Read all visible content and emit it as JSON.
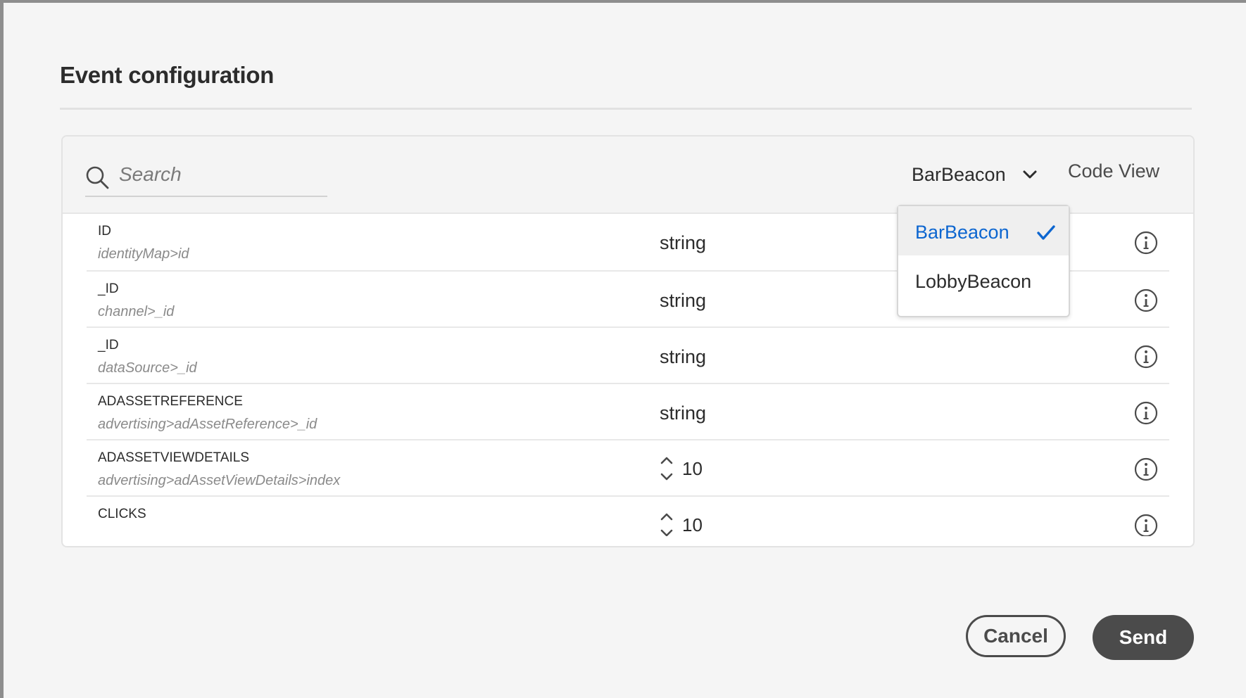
{
  "dialog": {
    "title": "Event configuration"
  },
  "search": {
    "placeholder": "Search"
  },
  "toolbar": {
    "selected_event": "BarBeacon",
    "code_view_label": "Code View"
  },
  "dropdown": {
    "options": [
      {
        "label": "BarBeacon",
        "selected": true
      },
      {
        "label": "LobbyBeacon",
        "selected": false
      }
    ]
  },
  "rows": [
    {
      "name": "ID",
      "path": "identityMap>id",
      "type": "string"
    },
    {
      "name": "_ID",
      "path": "channel>_id",
      "type": "string"
    },
    {
      "name": "_ID",
      "path": "dataSource>_id",
      "type": "string"
    },
    {
      "name": "ADASSETREFERENCE",
      "path": "advertising>adAssetReference>_id",
      "type": "string"
    },
    {
      "name": "ADASSETVIEWDETAILS",
      "path": "advertising>adAssetViewDetails>index",
      "value": "10"
    },
    {
      "name": "CLICKS",
      "path": "",
      "value": "10"
    }
  ],
  "footer": {
    "cancel_label": "Cancel",
    "send_label": "Send"
  },
  "colors": {
    "accent_blue": "#0d66d0",
    "button_dark": "#4b4b4b"
  }
}
